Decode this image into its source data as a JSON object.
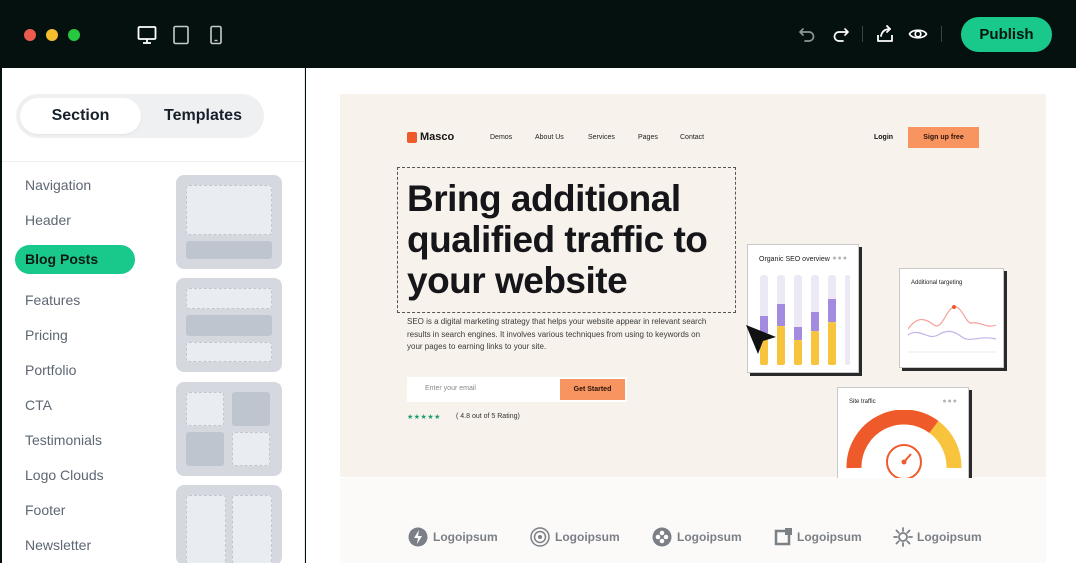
{
  "toolbar": {
    "window_dots": [
      "#ed5b4f",
      "#f5bc2e",
      "#27c840"
    ],
    "devices": [
      "desktop-icon",
      "tablet-icon",
      "mobile-icon"
    ],
    "actions": [
      "undo-icon",
      "redo-icon",
      "export-icon",
      "preview-icon"
    ],
    "publish_label": "Publish",
    "accent": "#19c98c"
  },
  "sidebar": {
    "tabs": [
      {
        "label": "Section",
        "active": true
      },
      {
        "label": "Templates",
        "active": false
      }
    ],
    "items": [
      {
        "label": "Navigation",
        "active": false
      },
      {
        "label": "Header",
        "active": false
      },
      {
        "label": "Blog Posts",
        "active": true
      },
      {
        "label": "Features",
        "active": false
      },
      {
        "label": "Pricing",
        "active": false
      },
      {
        "label": "Portfolio",
        "active": false
      },
      {
        "label": "CTA",
        "active": false
      },
      {
        "label": "Testimonials",
        "active": false
      },
      {
        "label": "Logo Clouds",
        "active": false
      },
      {
        "label": "Footer",
        "active": false
      },
      {
        "label": "Newsletter",
        "active": false
      }
    ]
  },
  "preview": {
    "brand": "Masco",
    "nav": [
      "Demos",
      "About Us",
      "Services",
      "Pages",
      "Contact"
    ],
    "login": "Login",
    "signup": "Sign up free",
    "headline": "Bring additional qualified traffic to your website",
    "subtext": "SEO is a digital marketing strategy that helps your website appear in relevant search results in search engines. It involves various techniques  from using to keywords on your pages to earning links to your site.",
    "email_placeholder": "Enter your email",
    "cta": "Get Started",
    "stars": "★★★★★",
    "rating": "( 4.8 out of 5 Rating)",
    "cards": {
      "seo_title": "Organic SEO overview",
      "targeting_title": "Additional targeting",
      "traffic_title": "Site traffic"
    },
    "logos": [
      "Logoipsum",
      "Logoipsum",
      "Logoipsum",
      "Logoipsum",
      "Logoipsum"
    ]
  }
}
